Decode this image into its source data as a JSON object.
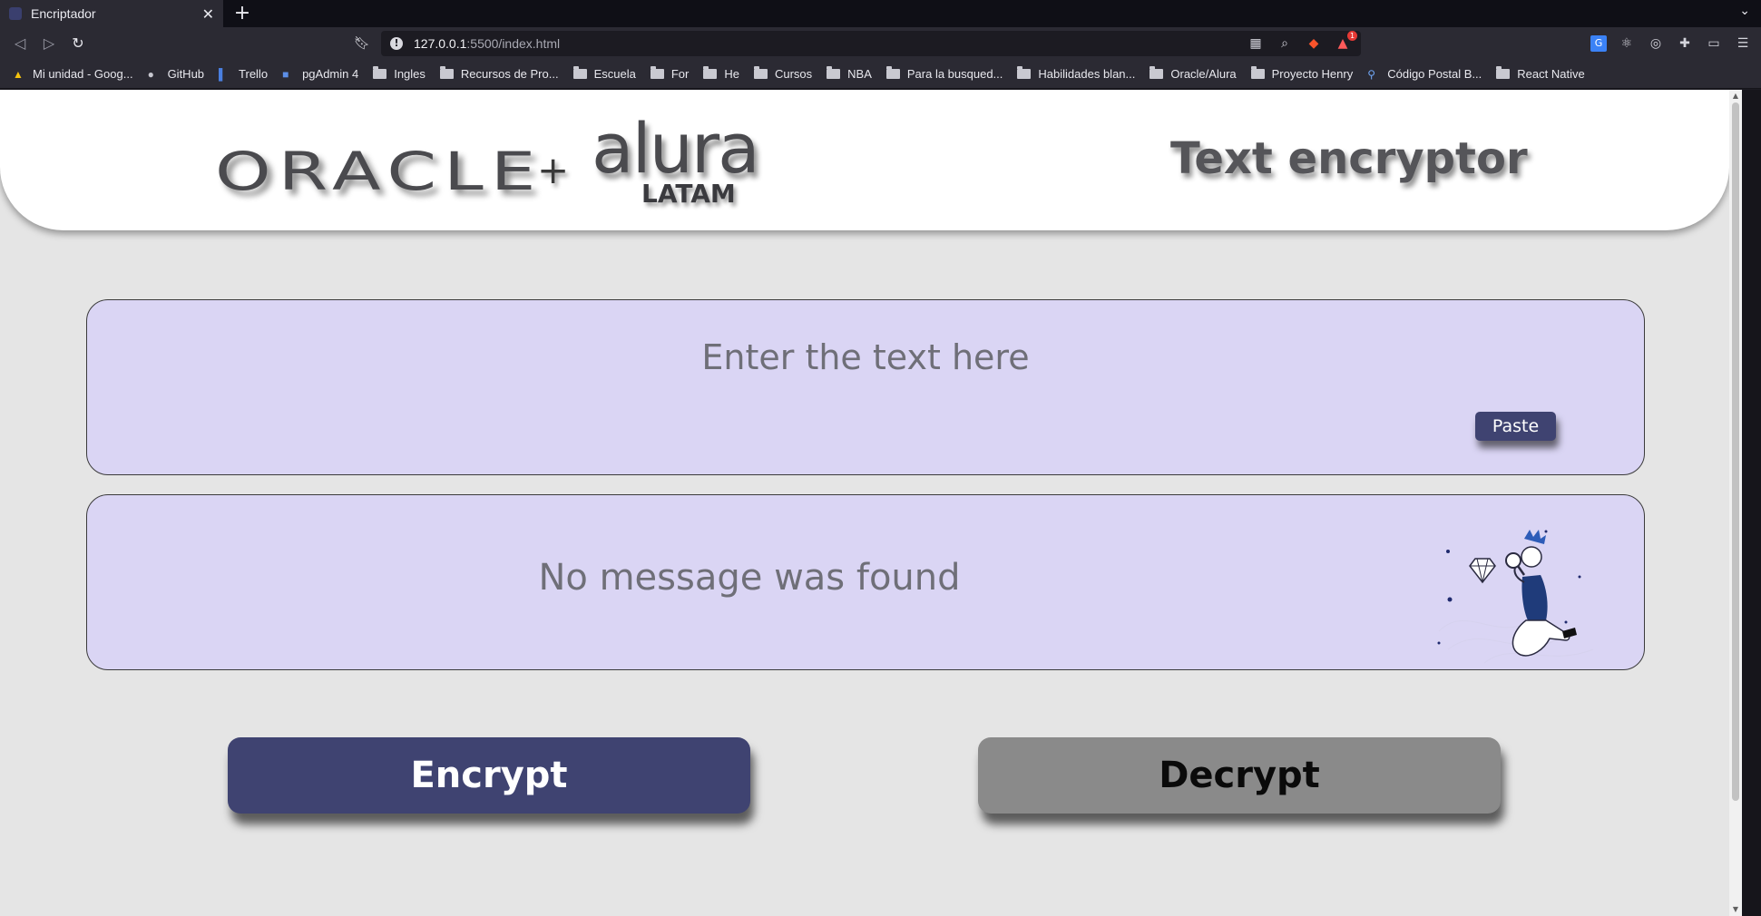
{
  "browser": {
    "tab_title": "Encriptador",
    "tab_close": "✕",
    "new_tab": "+",
    "url_host": "127.0.0.1",
    "url_rest": ":5500/index.html",
    "alert_count": "1",
    "bookmarks": [
      {
        "label": "Mi unidad - Goog...",
        "icon": "drive-icon"
      },
      {
        "label": "GitHub",
        "icon": "github-icon"
      },
      {
        "label": "Trello",
        "icon": "trello-icon"
      },
      {
        "label": "pgAdmin 4",
        "icon": "pgadmin-icon"
      },
      {
        "label": "Ingles",
        "icon": "folder-icon"
      },
      {
        "label": "Recursos de Pro...",
        "icon": "folder-icon"
      },
      {
        "label": "Escuela",
        "icon": "folder-icon"
      },
      {
        "label": "For",
        "icon": "folder-icon"
      },
      {
        "label": "He",
        "icon": "folder-icon"
      },
      {
        "label": "Cursos",
        "icon": "folder-icon"
      },
      {
        "label": "NBA",
        "icon": "folder-icon"
      },
      {
        "label": "Para la busqued...",
        "icon": "folder-icon"
      },
      {
        "label": "Habilidades blan...",
        "icon": "folder-icon"
      },
      {
        "label": "Oracle/Alura",
        "icon": "folder-icon"
      },
      {
        "label": "Proyecto Henry",
        "icon": "folder-icon"
      },
      {
        "label": "Código Postal B...",
        "icon": "location-icon"
      },
      {
        "label": "React Native",
        "icon": "folder-icon"
      }
    ]
  },
  "header": {
    "logo_oracle": "ORACLE",
    "logo_plus": "+",
    "logo_alura": "alura",
    "logo_latam": "LATAM",
    "title": "Text encryptor"
  },
  "input_panel": {
    "placeholder": "Enter the text here",
    "paste_label": "Paste"
  },
  "output_panel": {
    "message": "No message was found"
  },
  "actions": {
    "encrypt_label": "Encrypt",
    "decrypt_label": "Decrypt"
  },
  "colors": {
    "panel_bg": "#dad5f4",
    "primary": "#3f4371",
    "secondary": "#8a8a8a",
    "page_bg": "#e5e5e5"
  }
}
